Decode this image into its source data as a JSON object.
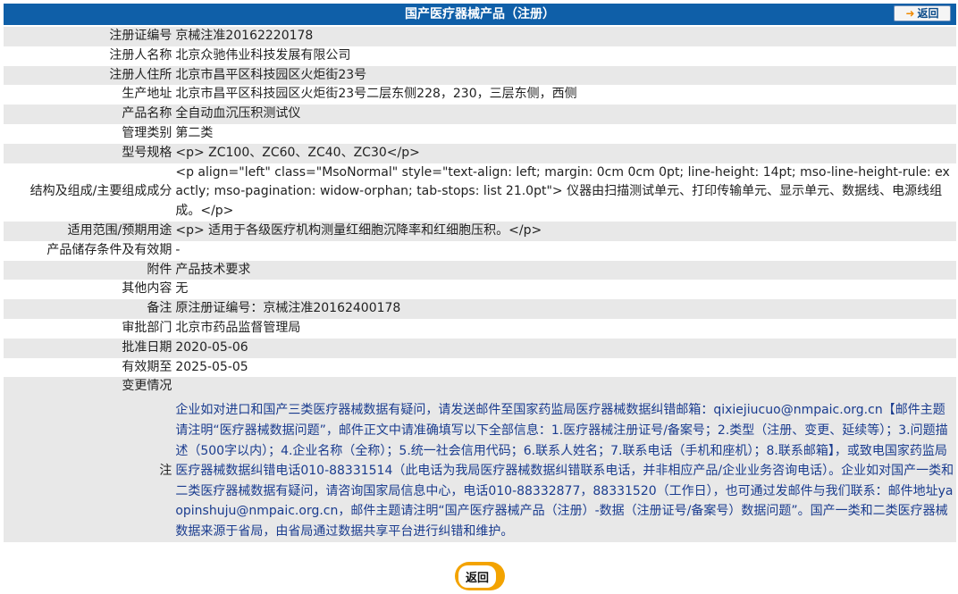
{
  "header": {
    "title": "国产医疗器械产品（注册）",
    "back_label": "返回"
  },
  "rows": [
    {
      "key": "注册证编号",
      "value": "京械注准20162220178"
    },
    {
      "key": "注册人名称",
      "value": "北京众驰伟业科技发展有限公司"
    },
    {
      "key": "注册人住所",
      "value": "北京市昌平区科技园区火炬街23号"
    },
    {
      "key": "生产地址",
      "value": "北京市昌平区科技园区火炬街23号二层东侧228，230，三层东侧，西侧"
    },
    {
      "key": "产品名称",
      "value": "全自动血沉压积测试仪"
    },
    {
      "key": "管理类别",
      "value": "第二类"
    },
    {
      "key": "型号规格",
      "value": "<p> ZC100、ZC60、ZC40、ZC30</p>"
    },
    {
      "key": "结构及组成/主要组成成分",
      "value": "<p align=\"left\" class=\"MsoNormal\" style=\"text-align: left; margin: 0cm 0cm 0pt; line-height: 14pt; mso-line-height-rule: exactly; mso-pagination: widow-orphan; tab-stops: list 21.0pt\"> 仪器由扫描测试单元、打印传输单元、显示单元、数据线、电源线组成。</p>"
    },
    {
      "key": "适用范围/预期用途",
      "value": "<p> 适用于各级医疗机构测量红细胞沉降率和红细胞压积。</p>"
    },
    {
      "key": "产品储存条件及有效期",
      "value": "-"
    },
    {
      "key": "附件",
      "value": "产品技术要求"
    },
    {
      "key": "其他内容",
      "value": "无"
    },
    {
      "key": "备注",
      "value": "原注册证编号：京械注准20162400178"
    },
    {
      "key": "审批部门",
      "value": "北京市药品监督管理局"
    },
    {
      "key": "批准日期",
      "value": "2020-05-06"
    },
    {
      "key": "有效期至",
      "value": "2025-05-05"
    }
  ],
  "changes": {
    "key": "变更情况",
    "value": ""
  },
  "note": {
    "key": "注",
    "value": "企业如对进口和国产三类医疗器械数据有疑问，请发送邮件至国家药监局医疗器械数据纠错邮箱：qixiejiucuo@nmpaic.org.cn【邮件主题请注明“医疗器械数据问题”，邮件正文中请准确填写以下全部信息：1.医疗器械注册证号/备案号；2.类型（注册、变更、延续等）；3.问题描述（500字以内）；4.企业名称（全称）；5.统一社会信用代码；6.联系人姓名；7.联系电话（手机和座机）；8.联系邮箱】，或致电国家药监局医疗器械数据纠错电话010-88331514（此电话为我局医疗器械数据纠错联系电话，并非相应产品/企业业务咨询电话）。企业如对国产一类和二类医疗器械数据有疑问，请咨询国家局信息中心，电话010-88332877，88331520（工作日），也可通过发邮件与我们联系：邮件地址yaopinshuju@nmpaic.org.cn，邮件主题请注明“国产医疗器械产品（注册）-数据（注册证号/备案号）数据问题”。国产一类和二类医疗器械数据来源于省局，由省局通过数据共享平台进行纠错和维护。"
  },
  "footer": {
    "back_label": "返回"
  },
  "colors": {
    "header_bg": "#0f5fa8",
    "row_alt_bg": "#e8e8e8",
    "note_text": "#1a3c8f",
    "back_button_accent": "#f3a300"
  },
  "icons": {
    "header_back": "arrow-right-icon",
    "footer_back": "back-button-icon"
  }
}
